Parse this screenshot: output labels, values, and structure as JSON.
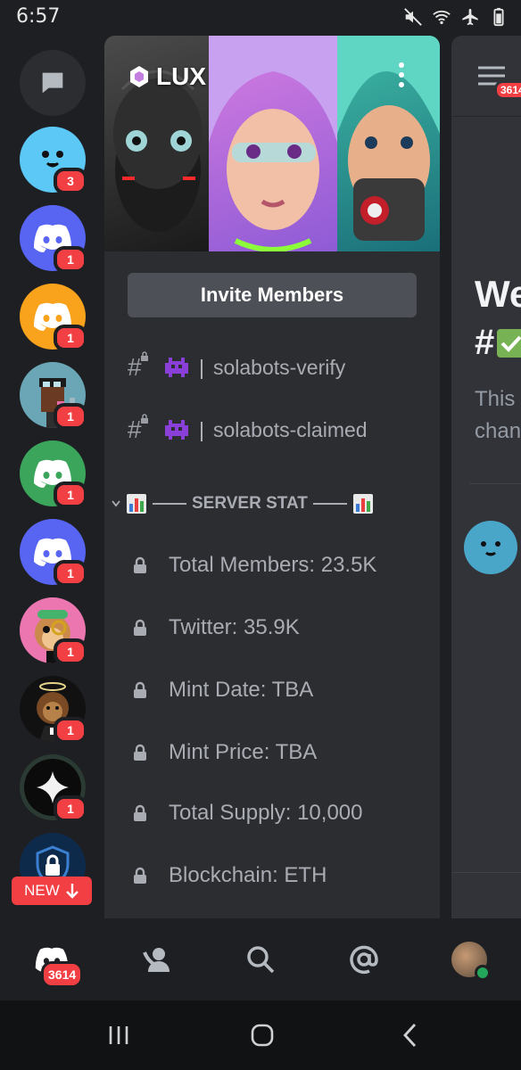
{
  "status_bar": {
    "time": "6:57",
    "icons": [
      "mute-icon",
      "wifi-icon",
      "airplane-icon",
      "battery-icon"
    ]
  },
  "server_rail": {
    "items": [
      {
        "name": "direct-messages",
        "icon": "chat-bubble-icon",
        "badge": ""
      },
      {
        "name": "server-blue-face",
        "icon": "face-icon",
        "badge": "3",
        "color": "#5bc8f5"
      },
      {
        "name": "server-discord-blurple",
        "icon": "discord-icon",
        "badge": "1",
        "color": "#5865f2"
      },
      {
        "name": "server-discord-orange",
        "icon": "discord-icon",
        "badge": "1",
        "color": "#f9a21b"
      },
      {
        "name": "server-pixel-avatar",
        "icon": "pixel-avatar-icon",
        "badge": "1",
        "color": "#6aa6b6"
      },
      {
        "name": "server-discord-green",
        "icon": "discord-icon",
        "badge": "1",
        "color": "#3ba55c"
      },
      {
        "name": "server-discord-blurple-2",
        "icon": "discord-icon",
        "badge": "1",
        "color": "#5865f2"
      },
      {
        "name": "server-monkey",
        "icon": "monkey-icon",
        "badge": "1",
        "color": "#ec76b0"
      },
      {
        "name": "server-lion",
        "icon": "lion-icon",
        "badge": "1",
        "color": "#111111"
      },
      {
        "name": "server-sparkle",
        "icon": "sparkle-icon",
        "badge": "1",
        "color": "#0b0b0b"
      },
      {
        "name": "server-shield",
        "icon": "shield-lock-icon",
        "badge": "",
        "color": "#0e2a4b"
      }
    ],
    "new_label": "NEW"
  },
  "panel": {
    "server_name": "LUX",
    "invite_label": "Invite Members",
    "channels": [
      {
        "name": "solabots-verify",
        "emoji": "alien-monster-icon",
        "sep": "|"
      },
      {
        "name": "solabots-claimed",
        "emoji": "alien-monster-icon",
        "sep": "|"
      }
    ],
    "category": "SERVER STAT",
    "stats": [
      "Total Members: 23.5K",
      "Twitter: 35.9K",
      "Mint Date: TBA",
      "Mint Price: TBA",
      "Total Supply: 10,000",
      "Blockchain: ETH"
    ]
  },
  "peek": {
    "badge": "3614",
    "title": "We",
    "hash": "#",
    "desc_line1": "This",
    "desc_line2": "chan"
  },
  "bottom_nav": {
    "home_badge": "3614",
    "items": [
      "home-icon",
      "friends-icon",
      "search-icon",
      "mentions-icon",
      "profile-avatar"
    ]
  },
  "colors": {
    "badge_red": "#f23f43",
    "rail_bg": "#1e1f22",
    "panel_bg": "#2b2d31",
    "online_green": "#23a55a"
  }
}
